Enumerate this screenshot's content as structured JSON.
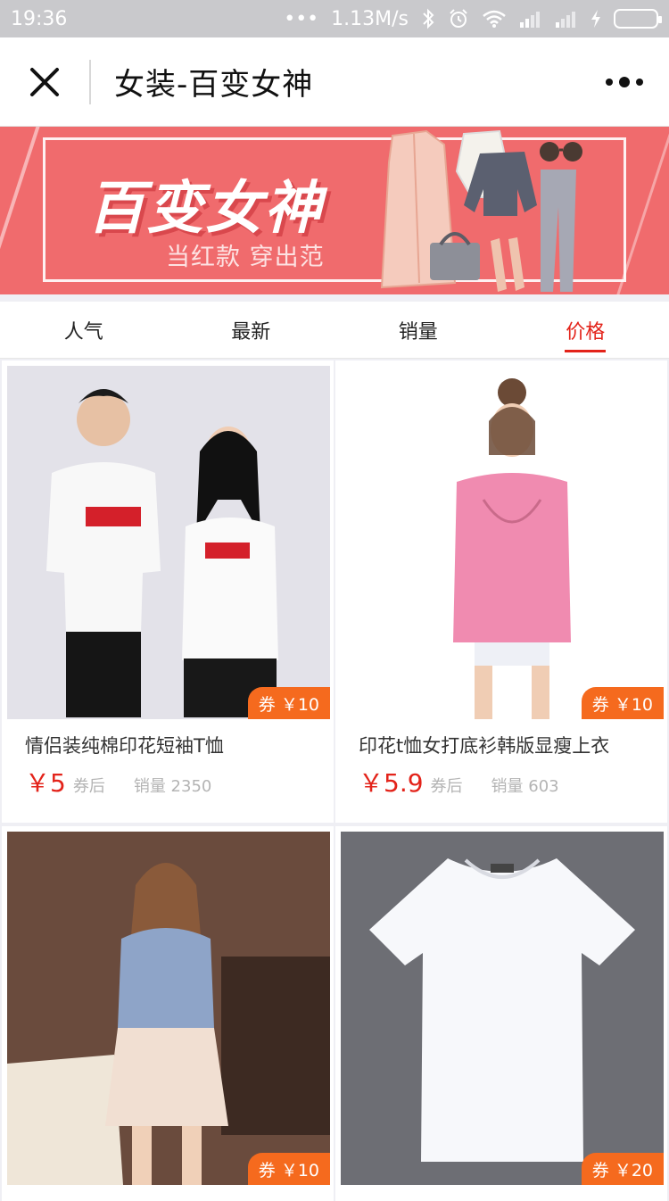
{
  "status_bar": {
    "time": "19:36",
    "dots": "•••",
    "network_speed": "1.13M/s",
    "icons": [
      "bluetooth-icon",
      "alarm-icon",
      "wifi-icon",
      "signal-icon",
      "signal-icon",
      "charging-icon",
      "battery-icon"
    ]
  },
  "nav": {
    "title": "女装-百变女神",
    "close_icon": "close-icon",
    "more_icon": "more-icon"
  },
  "banner": {
    "title": "百变女神",
    "subtitle": "当红款 穿出范",
    "background_color": "#f06b6d"
  },
  "tabs": [
    {
      "label": "人气",
      "active": false
    },
    {
      "label": "最新",
      "active": false
    },
    {
      "label": "销量",
      "active": false
    },
    {
      "label": "价格",
      "active": true
    }
  ],
  "accent_color": "#e3231a",
  "coupon_color": "#f56a1e",
  "products": [
    {
      "title": "情侣装纯棉印花短袖T恤",
      "price": "￥5",
      "after_label": "券后",
      "sales": "销量 2350",
      "coupon": "券 ￥10",
      "image_text": "Supreme"
    },
    {
      "title": "印花t恤女打底衫韩版显瘦上衣",
      "price": "￥5.9",
      "after_label": "券后",
      "sales": "销量 603",
      "coupon": "券 ￥10"
    },
    {
      "title": "",
      "price": "",
      "after_label": "",
      "sales": "",
      "coupon": "券 ￥10"
    },
    {
      "title": "",
      "price": "",
      "after_label": "",
      "sales": "",
      "coupon": "券 ￥20"
    }
  ]
}
